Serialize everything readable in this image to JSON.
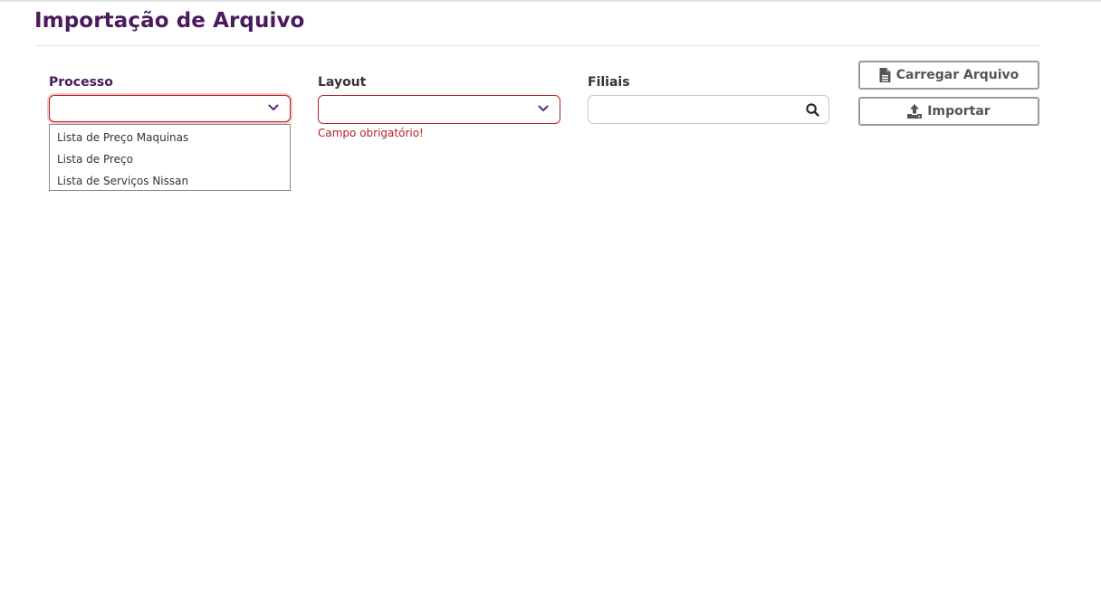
{
  "page": {
    "title": "Importação de Arquivo"
  },
  "form": {
    "processo": {
      "label": "Processo",
      "value": "",
      "options": [
        "Lista de Preço Maquinas",
        "Lista de Preço",
        "Lista de Serviços Nissan"
      ]
    },
    "layout": {
      "label": "Layout",
      "value": "",
      "error": "Campo obrigatório!"
    },
    "filiais": {
      "label": "Filiais",
      "value": "",
      "placeholder": ""
    }
  },
  "actions": {
    "load_label": "Carregar Arquivo",
    "import_label": "Importar"
  },
  "icons": {
    "chevron": "chevron-down-icon",
    "search": "search-icon",
    "file": "file-icon",
    "upload": "upload-icon"
  },
  "colors": {
    "title": "#4a1a5c",
    "error": "#b3222a",
    "chevron": "#5b2a86"
  }
}
